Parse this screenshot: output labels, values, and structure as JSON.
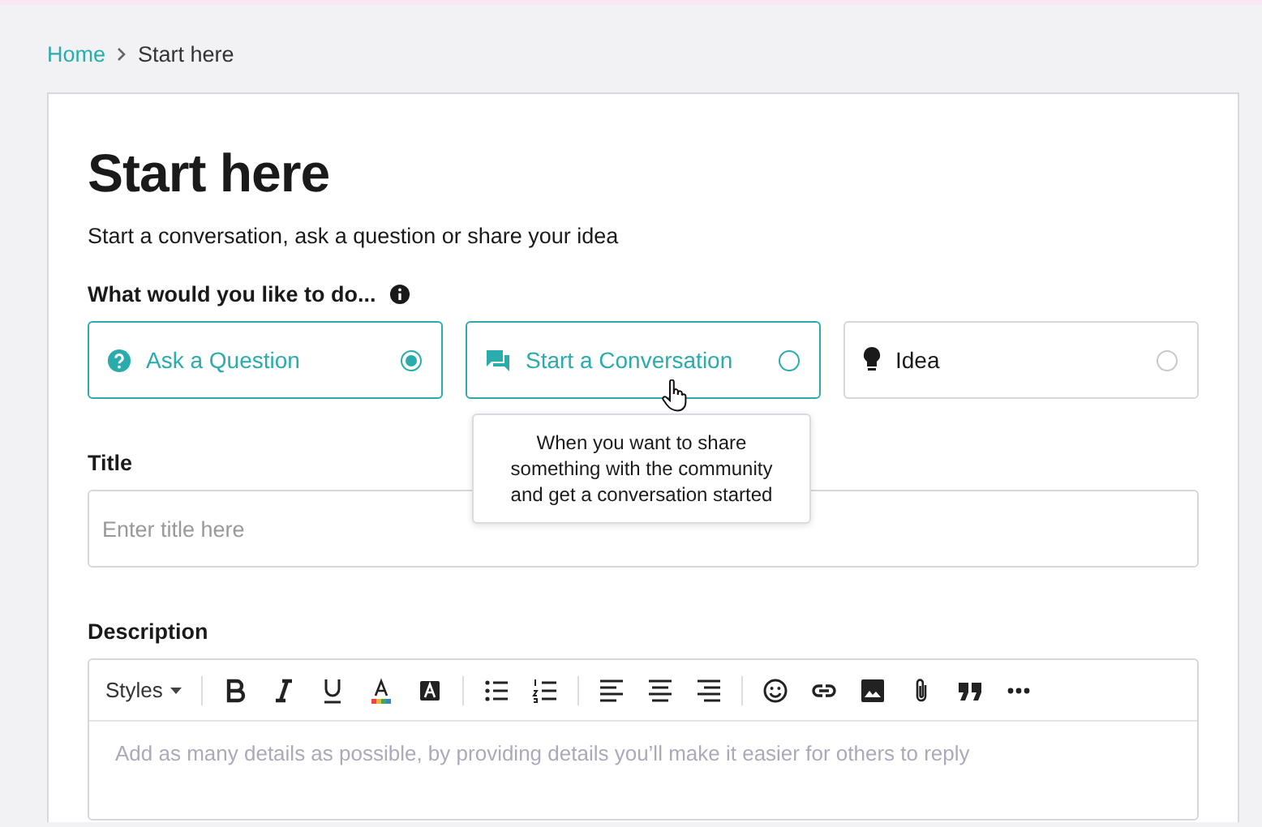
{
  "breadcrumb": [
    {
      "label": "Home",
      "kind": "link"
    },
    {
      "label": "Start here",
      "kind": "current"
    }
  ],
  "heading": "Start here",
  "subtitle": "Start a conversation, ask a question or share your idea",
  "type_question": {
    "label": "What would you like to do...",
    "options": [
      {
        "kind": "question",
        "label": "Ask a Question",
        "selected": true,
        "hovered": false
      },
      {
        "kind": "conversation",
        "label": "Start a Conversation",
        "selected": false,
        "hovered": true
      },
      {
        "kind": "idea",
        "label": "Idea",
        "selected": false,
        "hovered": false
      }
    ]
  },
  "tooltip": "When you want to share something with the community and get a conversation started",
  "title_field": {
    "label": "Title",
    "placeholder": "Enter title here"
  },
  "description_field": {
    "label": "Description",
    "styles_label": "Styles",
    "placeholder": "Add as many details as possible, by providing details you’ll make it easier for others to reply"
  }
}
